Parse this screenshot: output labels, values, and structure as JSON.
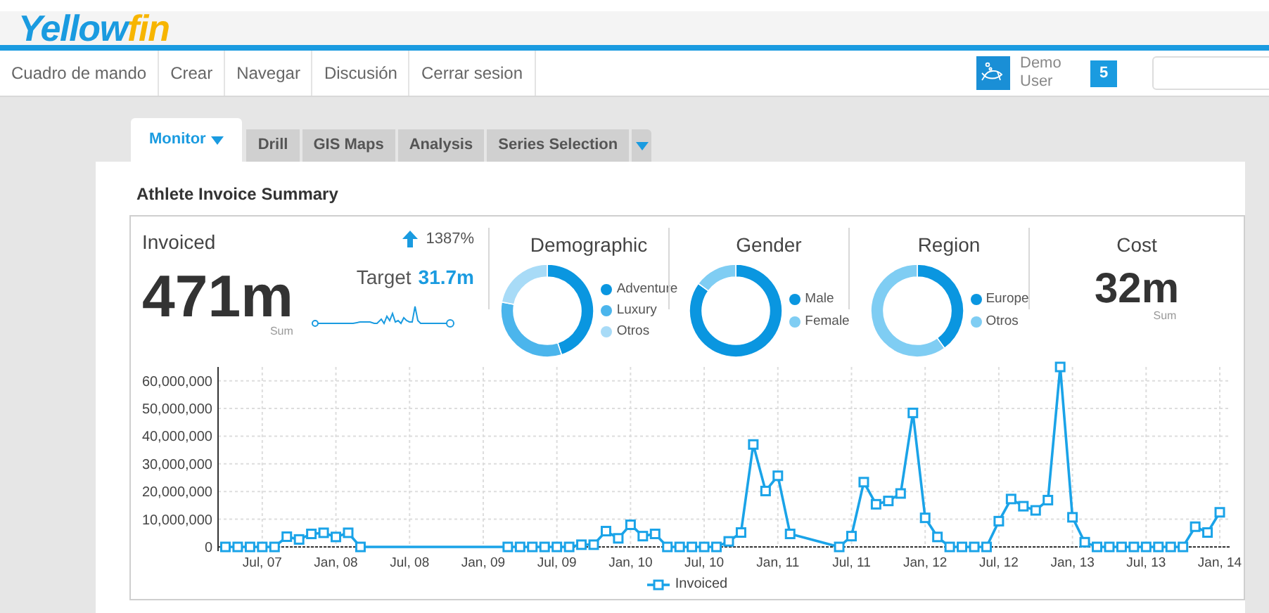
{
  "logo": [
    {
      "text": "Yellow"
    },
    {
      "text": "fin"
    }
  ],
  "nav": [
    {
      "label": "Cuadro de mando"
    },
    {
      "label": "Crear"
    },
    {
      "label": "Navegar"
    },
    {
      "label": "Discusión"
    },
    {
      "label": "Cerrar sesion"
    }
  ],
  "user": {
    "first_name": "Demo",
    "last_name": "User",
    "notifications": "5"
  },
  "tabs": [
    {
      "label": "Monitor",
      "selected": true,
      "menu": true
    },
    {
      "label": "Drill",
      "selected": false,
      "menu": false
    },
    {
      "label": "GIS Maps",
      "selected": false,
      "menu": false
    },
    {
      "label": "Analysis",
      "selected": false,
      "menu": false
    },
    {
      "label": "Series Selection",
      "selected": false,
      "menu": false
    }
  ],
  "report": {
    "title": "Athlete Invoice Summary",
    "invoiced": {
      "title": "Invoiced",
      "value": "471m",
      "aggregate": "Sum",
      "change": "1387%",
      "target_label": "Target",
      "target_value": "31.7m"
    },
    "donuts": [
      {
        "title": "Demographic",
        "legend": [
          {
            "label": "Adventure",
            "color": "#0a96e0"
          },
          {
            "label": "Luxury",
            "color": "#4bb5ec"
          },
          {
            "label": "Otros",
            "color": "#a8dbf7"
          }
        ]
      },
      {
        "title": "Gender",
        "legend": [
          {
            "label": "Male",
            "color": "#0a96e0"
          },
          {
            "label": "Female",
            "color": "#7fcdf3"
          }
        ]
      },
      {
        "title": "Region",
        "legend": [
          {
            "label": "Europe",
            "color": "#0a96e0"
          },
          {
            "label": "Otros",
            "color": "#7fcdf3"
          }
        ]
      }
    ],
    "cost": {
      "title": "Cost",
      "value": "32m",
      "aggregate": "Sum"
    },
    "chart_data": {
      "type": "line",
      "grid": true,
      "ylim": [
        0,
        65000000
      ],
      "categories": [
        null,
        null,
        null,
        "Jul, 07",
        null,
        null,
        null,
        null,
        null,
        "Jan, 08",
        null,
        null,
        null,
        null,
        null,
        "Jul, 08",
        null,
        null,
        null,
        null,
        null,
        "Jan, 09",
        null,
        null,
        null,
        null,
        null,
        "Jul, 09",
        null,
        null,
        null,
        null,
        null,
        "Jan, 10",
        null,
        null,
        null,
        null,
        null,
        "Jul, 10",
        null,
        null,
        null,
        null,
        null,
        "Jan, 11",
        null,
        null,
        null,
        null,
        null,
        "Jul, 11",
        null,
        null,
        null,
        null,
        null,
        "Jan, 12",
        null,
        null,
        null,
        null,
        null,
        "Jul, 12",
        null,
        null,
        null,
        null,
        null,
        "Jan, 13",
        null,
        null,
        null,
        null,
        null,
        "Jul, 13",
        null,
        null,
        null,
        null,
        null,
        "Jan, 14"
      ],
      "yticks": [
        {
          "value": 0,
          "label": "0"
        },
        {
          "value": 10000000,
          "label": "10,000,000"
        },
        {
          "value": 20000000,
          "label": "20,000,000"
        },
        {
          "value": 30000000,
          "label": "30,000,000"
        },
        {
          "value": 40000000,
          "label": "40,000,000"
        },
        {
          "value": 50000000,
          "label": "50,000,000"
        },
        {
          "value": 60000000,
          "label": "60,000,000"
        }
      ],
      "series": [
        {
          "name": "Invoiced",
          "color": "#1aa3e8",
          "marker": "square",
          "values": [
            0,
            0,
            0,
            0,
            0,
            3700000,
            2700000,
            4700000,
            5100000,
            3600000,
            5100000,
            0,
            null,
            null,
            null,
            null,
            null,
            null,
            null,
            null,
            null,
            null,
            null,
            0,
            0,
            0,
            0,
            0,
            0,
            800000,
            800000,
            5700000,
            3100000,
            8000000,
            3900000,
            4700000,
            0,
            0,
            0,
            0,
            0,
            2000000,
            5200000,
            37000000,
            20200000,
            25700000,
            4700000,
            null,
            null,
            null,
            0,
            3900000,
            23400000,
            15400000,
            16600000,
            19300000,
            48400000,
            10500000,
            3600000,
            0,
            0,
            0,
            0,
            9300000,
            17300000,
            14700000,
            13200000,
            16900000,
            65000000,
            10700000,
            1700000,
            0,
            0,
            0,
            0,
            0,
            0,
            0,
            0,
            7300000,
            5200000,
            12500000
          ]
        }
      ]
    }
  }
}
